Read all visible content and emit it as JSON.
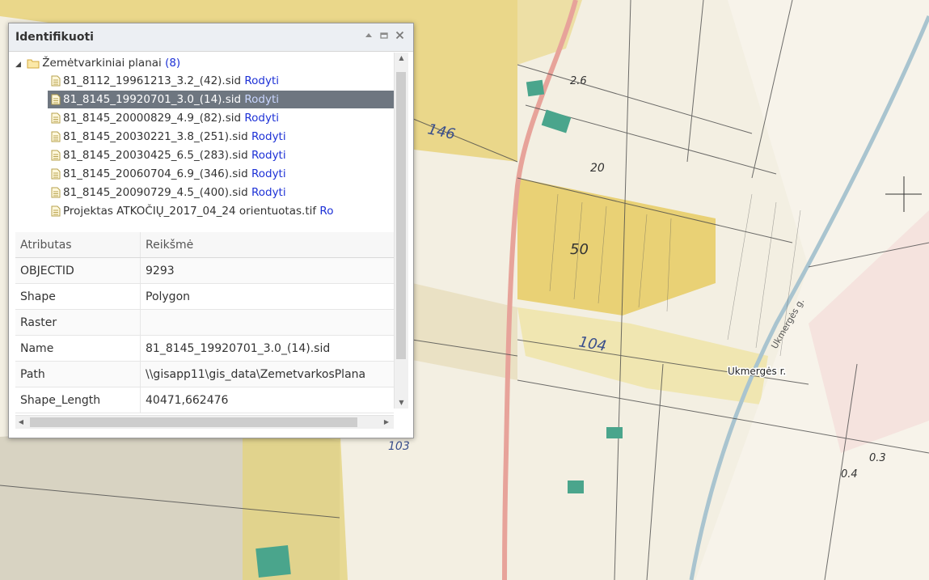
{
  "panel": {
    "title": "Identifikuoti",
    "minimize_icon": "triangle-up-icon",
    "maximize_icon": "square-icon",
    "close_icon": "x-icon"
  },
  "tree": {
    "group_label": "Žemėtvarkiniai planai",
    "group_count": "(8)",
    "items": [
      {
        "name": "81_8112_19961213_3.2_(42).sid",
        "link": "Rodyti",
        "selected": false
      },
      {
        "name": "81_8145_19920701_3.0_(14).sid",
        "link": "Rodyti",
        "selected": true
      },
      {
        "name": "81_8145_20000829_4.9_(82).sid",
        "link": "Rodyti",
        "selected": false
      },
      {
        "name": "81_8145_20030221_3.8_(251).sid",
        "link": "Rodyti",
        "selected": false
      },
      {
        "name": "81_8145_20030425_6.5_(283).sid",
        "link": "Rodyti",
        "selected": false
      },
      {
        "name": "81_8145_20060704_6.9_(346).sid",
        "link": "Rodyti",
        "selected": false
      },
      {
        "name": "81_8145_20090729_4.5_(400).sid",
        "link": "Rodyti",
        "selected": false
      },
      {
        "name": "Projektas ATKOČIŲ_2017_04_24 orientuotas.tif",
        "link": "Ro",
        "selected": false
      }
    ]
  },
  "attributes": {
    "header": {
      "col1": "Atributas",
      "col2": "Reikšmė"
    },
    "rows": [
      {
        "key": "OBJECTID",
        "value": "9293"
      },
      {
        "key": "Shape",
        "value": "Polygon"
      },
      {
        "key": "Raster",
        "value": ""
      },
      {
        "key": "Name",
        "value": "81_8145_19920701_3.0_(14).sid"
      },
      {
        "key": "Path",
        "value": "\\\\gisapp11\\gis_data\\ZemetvarkosPlana"
      },
      {
        "key": "Shape_Length",
        "value": "40471,662476"
      }
    ]
  },
  "map": {
    "place_label": "Ukmergės r.",
    "handwritten_labels": [
      "104",
      "146",
      "103",
      "50",
      "20",
      "0.4",
      "0.3",
      "2.6"
    ],
    "road_label": "Ukmergės g."
  }
}
